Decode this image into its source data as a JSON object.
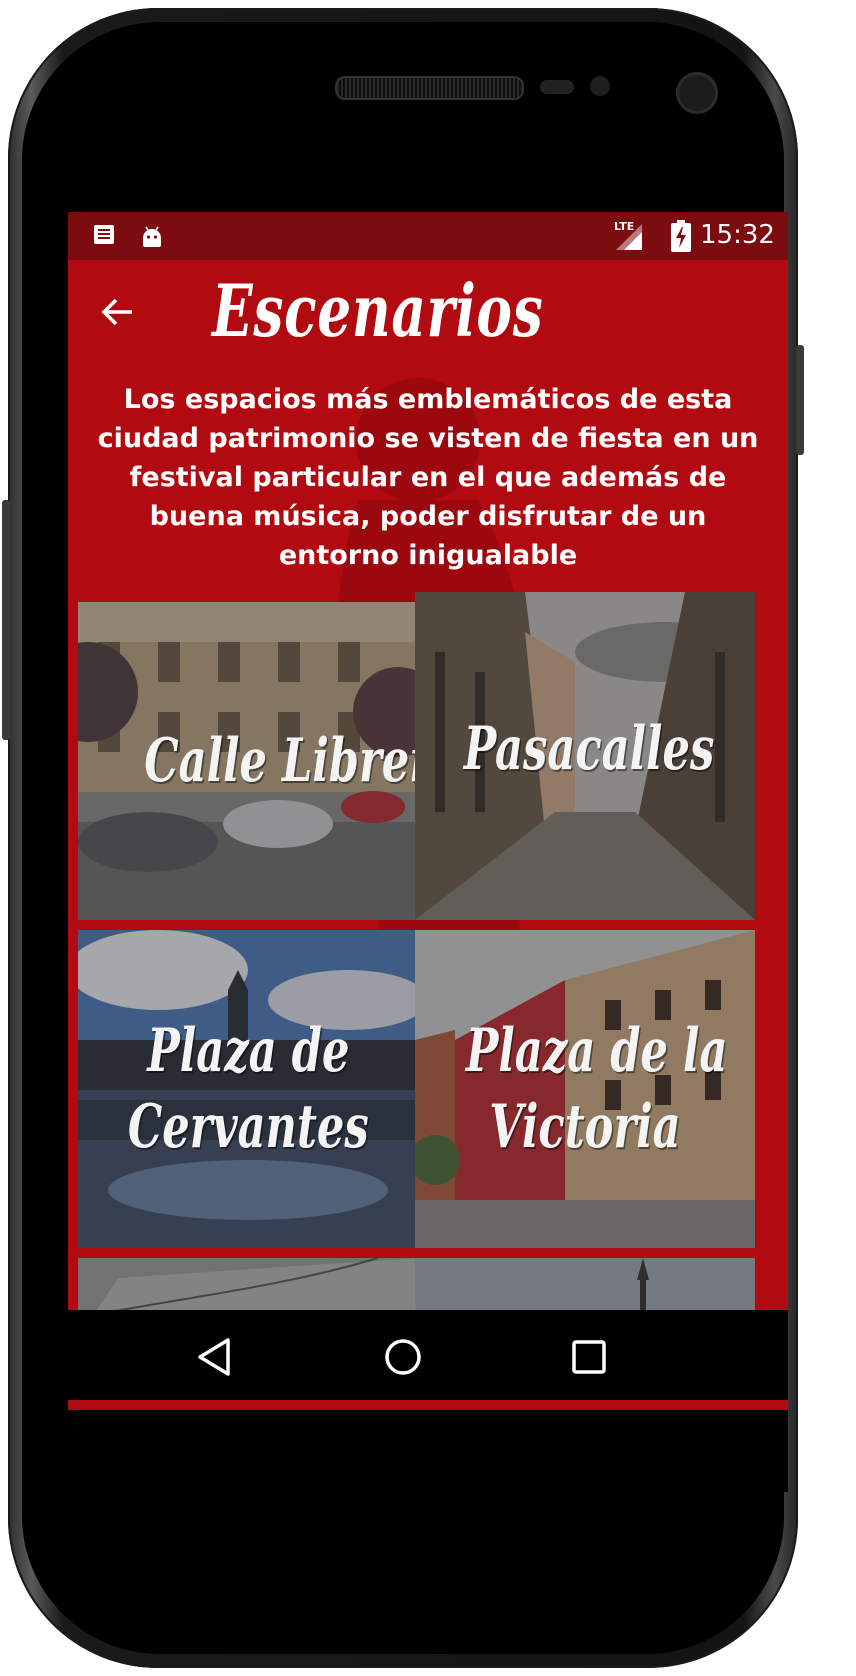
{
  "status_bar": {
    "time": "15:32",
    "network": "LTE",
    "icons": [
      "news-notification-icon",
      "android-notification-icon",
      "signal-icon",
      "battery-charging-icon"
    ]
  },
  "app": {
    "title": "Escenarios",
    "intro": "Los espacios más emblemáticos de esta ciudad patrimonio se visten de fiesta en un festival particular en el que además de buena música, poder disfrutar de un entorno inigualable",
    "colors": {
      "primary": "#b10a10",
      "status_bar": "#7c0c10",
      "text": "#ffffff"
    }
  },
  "venues": [
    {
      "line1": "Calle Libreros",
      "line2": ""
    },
    {
      "line1": "Pasacalles",
      "line2": ""
    },
    {
      "line1": "Plaza de",
      "line2": "Cervantes"
    },
    {
      "line1": "Plaza de la",
      "line2": "Victoria"
    }
  ],
  "nav_bar": {
    "buttons": [
      "back-triangle-icon",
      "home-circle-icon",
      "recents-square-icon"
    ]
  }
}
